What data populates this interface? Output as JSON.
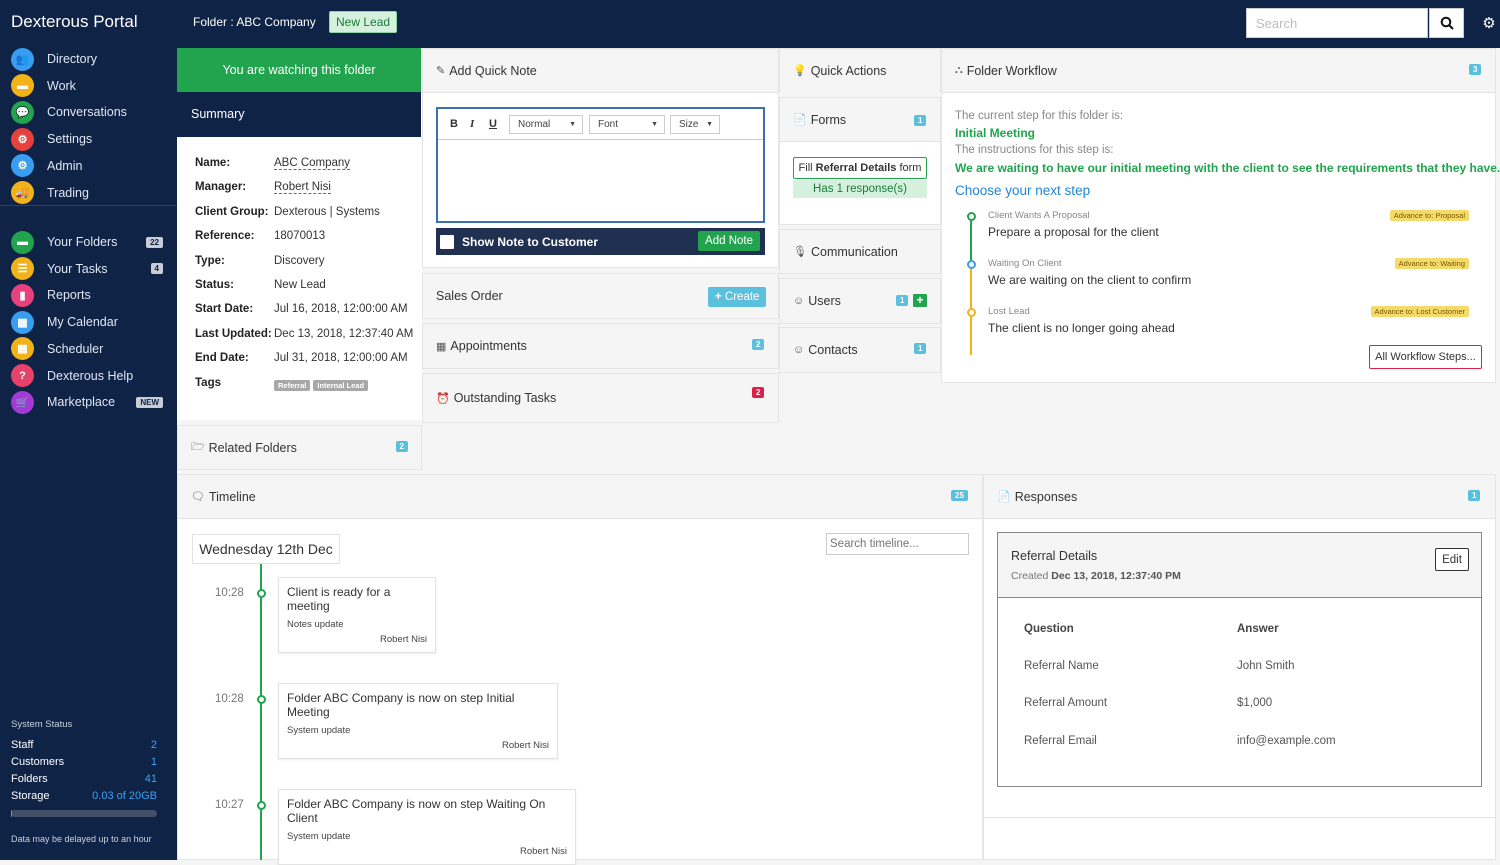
{
  "app": {
    "title": "Dexterous Portal"
  },
  "header": {
    "folder_label": "Folder : ABC Company",
    "status_badge": "New Lead",
    "search_placeholder": "Search"
  },
  "sidebar": {
    "items": [
      {
        "label": "Directory",
        "icon": "users-icon",
        "color": "#3a9ef0"
      },
      {
        "label": "Work",
        "icon": "folder-icon",
        "color": "#f2b31a"
      },
      {
        "label": "Conversations",
        "icon": "chat-icon",
        "color": "#21a44d"
      },
      {
        "label": "Settings",
        "icon": "cogs-icon",
        "color": "#e8413b"
      },
      {
        "label": "Admin",
        "icon": "admin-icon",
        "color": "#3a9ef0"
      },
      {
        "label": "Trading",
        "icon": "truck-icon",
        "color": "#f2b31a"
      }
    ],
    "items2": [
      {
        "label": "Your Folders",
        "icon": "folder-icon",
        "color": "#21a44d",
        "count": "22"
      },
      {
        "label": "Your Tasks",
        "icon": "tasks-icon",
        "color": "#f2b31a",
        "count": "4"
      },
      {
        "label": "Reports",
        "icon": "chart-icon",
        "color": "#e8417b"
      },
      {
        "label": "My Calendar",
        "icon": "calendar-icon",
        "color": "#3a9ef0"
      },
      {
        "label": "Scheduler",
        "icon": "scheduler-icon",
        "color": "#f2b31a"
      },
      {
        "label": "Dexterous Help",
        "icon": "help-icon",
        "color": "#e8416b"
      },
      {
        "label": "Marketplace",
        "icon": "cart-icon",
        "color": "#a43ad6",
        "count": "NEW"
      }
    ],
    "system": {
      "title": "System Status",
      "rows": [
        {
          "label": "Staff",
          "value": "2"
        },
        {
          "label": "Customers",
          "value": "1"
        },
        {
          "label": "Folders",
          "value": "41"
        },
        {
          "label": "Storage",
          "value": "0.03 of 20GB"
        }
      ],
      "storage_fraction": 0.0015,
      "note": "Data may be delayed up to an hour"
    }
  },
  "summary": {
    "watching": "You are watching this folder",
    "title": "Summary",
    "fields": [
      {
        "k": "Name:",
        "v": "ABC Company"
      },
      {
        "k": "Manager:",
        "v": "Robert Nisi"
      },
      {
        "k": "Client Group:",
        "v": "Dexterous | Systems"
      },
      {
        "k": "Reference:",
        "v": "18070013"
      },
      {
        "k": "Type:",
        "v": "Discovery"
      },
      {
        "k": "Status:",
        "v": "New Lead"
      },
      {
        "k": "Start Date:",
        "v": "Jul 16, 2018, 12:00:00 AM"
      },
      {
        "k": "Last Updated:",
        "v": "Dec 13, 2018, 12:37:40 AM"
      },
      {
        "k": "End Date:",
        "v": "Jul 31, 2018, 12:00:00 AM"
      },
      {
        "k": "Tags",
        "v": ""
      }
    ],
    "tags": [
      "Referral",
      "Internal Lead"
    ],
    "related_folders": "Related Folders",
    "related_count": "2"
  },
  "quicknote": {
    "title": "Add Quick Note",
    "bold": "B",
    "italic": "I",
    "underline": "U",
    "normal": "Normal",
    "font": "Font",
    "size": "Size",
    "show_note": "Show Note to Customer",
    "add_note": "Add Note"
  },
  "sales_order": {
    "title": "Sales Order",
    "button": "Create"
  },
  "appointments": {
    "title": "Appointments",
    "count": "2"
  },
  "tasks": {
    "title": "Outstanding Tasks",
    "count": "2"
  },
  "quick_actions": {
    "title": "Quick Actions"
  },
  "forms": {
    "title": "Forms",
    "count": "1",
    "fill_prefix": "Fill",
    "fill_bold": "Referral Details",
    "fill_suffix": "form",
    "responses": "Has 1 response(s)"
  },
  "communication": {
    "title": "Communication"
  },
  "users": {
    "title": "Users",
    "count": "1"
  },
  "contacts": {
    "title": "Contacts",
    "count": "1"
  },
  "workflow": {
    "title": "Folder Workflow",
    "count": "3",
    "current_label": "The current step for this folder is:",
    "current_step": "Initial Meeting",
    "instructions_label": "The instructions for this step is:",
    "instructions": "We are waiting to have our initial meeting with the client to see the requirements that they have.",
    "choose": "Choose your next step",
    "steps": [
      {
        "title": "Client Wants A Proposal",
        "desc": "Prepare a proposal for the client",
        "advance": "Advance to: Proposal",
        "color": "#21a44d"
      },
      {
        "title": "Waiting On Client",
        "desc": "We are waiting on the client to confirm",
        "advance": "Advance to: Waiting",
        "color": "#3a9ef0"
      },
      {
        "title": "Lost Lead",
        "desc": "The client is no longer going ahead",
        "advance": "Advance to: Lost Customer",
        "color": "#f2b31a"
      }
    ],
    "all_steps": "All Workflow Steps..."
  },
  "timeline": {
    "title": "Timeline",
    "count": "25",
    "date": "Wednesday 12th Dec",
    "search_placeholder": "Search timeline...",
    "events": [
      {
        "time": "10:28",
        "title": "Client is ready for a meeting",
        "sub": "Notes update",
        "author": "Robert Nisi"
      },
      {
        "time": "10:28",
        "title": "Folder ABC Company is now on step Initial Meeting",
        "sub": "System update",
        "author": "Robert Nisi"
      },
      {
        "time": "10:27",
        "title": "Folder ABC Company is now on step Waiting On Client",
        "sub": "System update",
        "author": "Robert Nisi"
      }
    ]
  },
  "responses": {
    "title": "Responses",
    "count": "1",
    "card_title": "Referral Details",
    "created_label": "Created",
    "created_value": "Dec 13, 2018, 12:37:40 PM",
    "edit": "Edit",
    "col_q": "Question",
    "col_a": "Answer",
    "rows": [
      {
        "q": "Referral Name",
        "a": "John Smith"
      },
      {
        "q": "Referral Amount",
        "a": "$1,000"
      },
      {
        "q": "Referral Email",
        "a": "info@example.com"
      }
    ]
  }
}
